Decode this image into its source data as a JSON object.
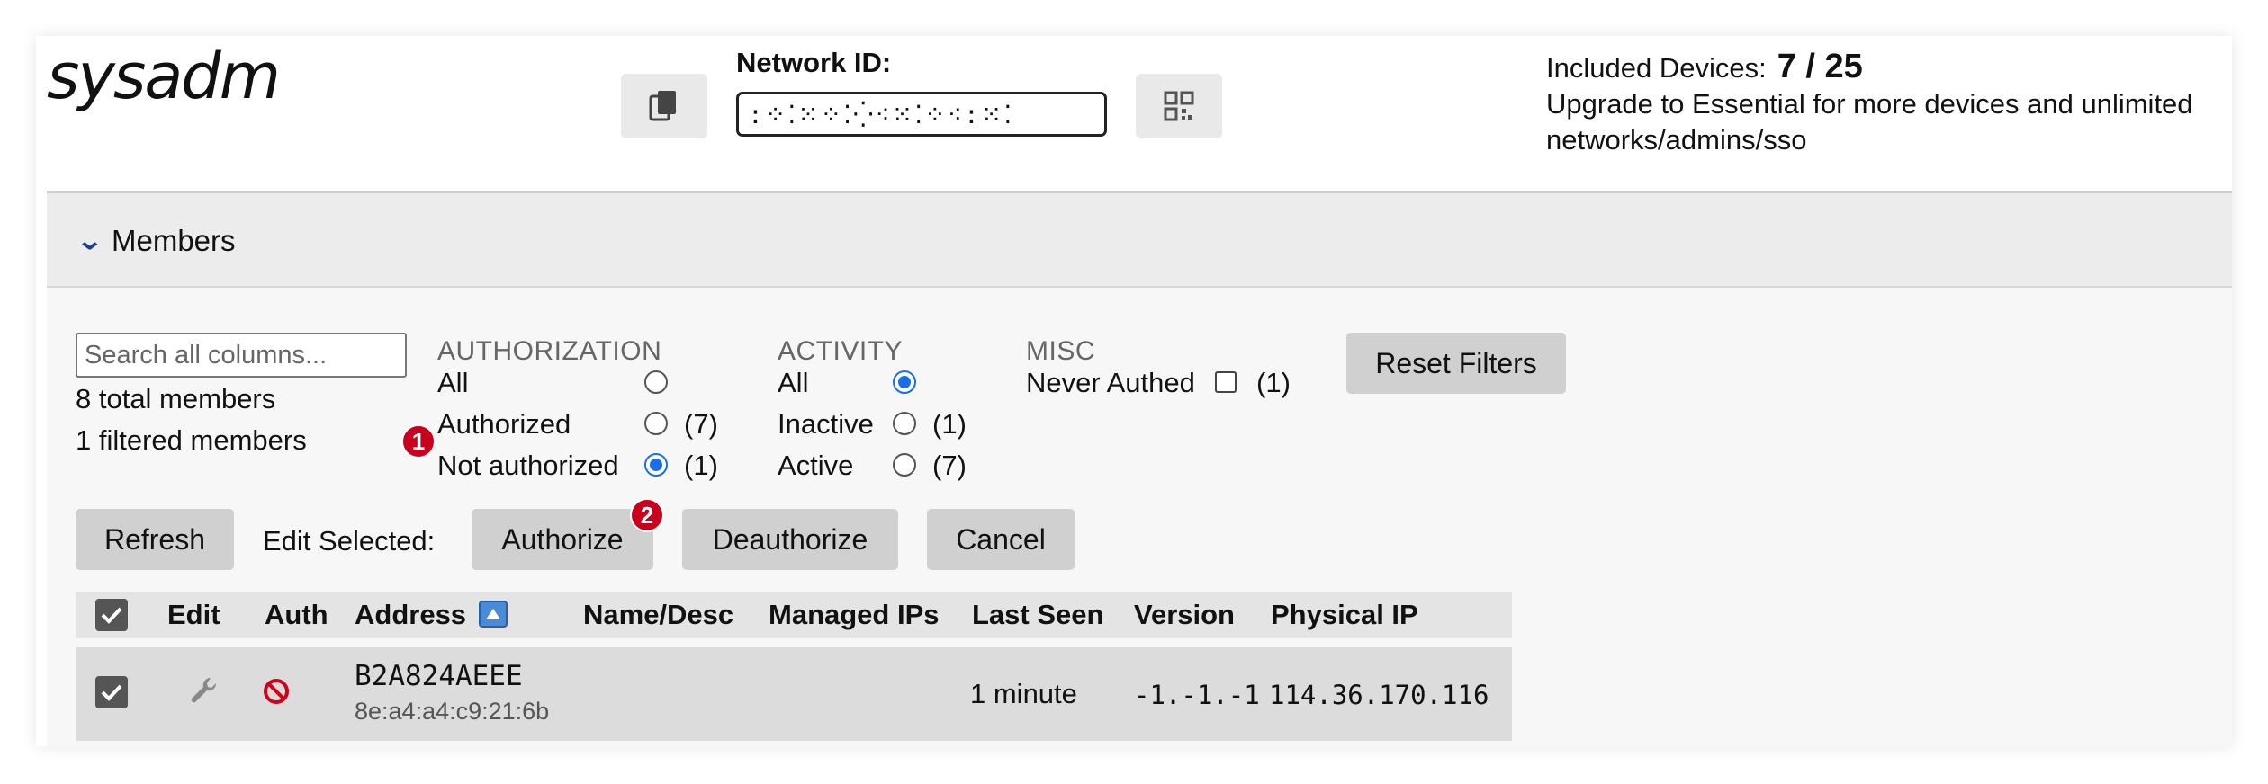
{
  "header": {
    "brand": "sysadm",
    "network_id_label": "Network ID:",
    "network_id_value": ":⁘⁚⁙⁘⁚⁛⁖⁙⁚⁘⁖:⁙⁚",
    "included_devices_label": "Included Devices:",
    "included_devices_count": "7 / 25",
    "upgrade_line1": "Upgrade to Essential for more devices and unlimited",
    "upgrade_line2": "networks/admins/sso",
    "icons": {
      "copy": "copy-icon",
      "qr": "qr-code-icon"
    }
  },
  "members": {
    "title": "Members",
    "search_placeholder": "Search all columns...",
    "total": "8 total members",
    "filtered": "1 filtered members"
  },
  "filters": {
    "authorization": {
      "heading": "AUTHORIZATION",
      "options": [
        {
          "label": "All",
          "count": "",
          "selected": false
        },
        {
          "label": "Authorized",
          "count": "(7)",
          "selected": false
        },
        {
          "label": "Not authorized",
          "count": "(1)",
          "selected": true
        }
      ]
    },
    "activity": {
      "heading": "ACTIVITY",
      "options": [
        {
          "label": "All",
          "count": "",
          "selected": true
        },
        {
          "label": "Inactive",
          "count": "(1)",
          "selected": false
        },
        {
          "label": "Active",
          "count": "(7)",
          "selected": false
        }
      ]
    },
    "misc": {
      "heading": "MISC",
      "never_authed_label": "Never Authed",
      "never_authed_count": "(1)",
      "never_authed_checked": false
    },
    "reset_label": "Reset Filters"
  },
  "actions": {
    "refresh": "Refresh",
    "edit_selected": "Edit Selected:",
    "authorize": "Authorize",
    "deauthorize": "Deauthorize",
    "cancel": "Cancel"
  },
  "markers": {
    "one": "1",
    "two": "2"
  },
  "table": {
    "columns": [
      "Edit",
      "Auth",
      "Address",
      "Name/Desc",
      "Managed IPs",
      "Last Seen",
      "Version",
      "Physical IP"
    ],
    "rows": [
      {
        "address": "B2A824AEEE",
        "mac": "8e:a4:a4:c9:21:6b",
        "name": "",
        "managed_ips": "",
        "last_seen": "1 minute",
        "version": "-1.-1.-1",
        "physical_ip": "114.36.170.116",
        "checked": true
      }
    ]
  },
  "colors": {
    "accent": "#1a6ee8",
    "badge": "#c8001e",
    "chevron": "#1f3c8a"
  }
}
